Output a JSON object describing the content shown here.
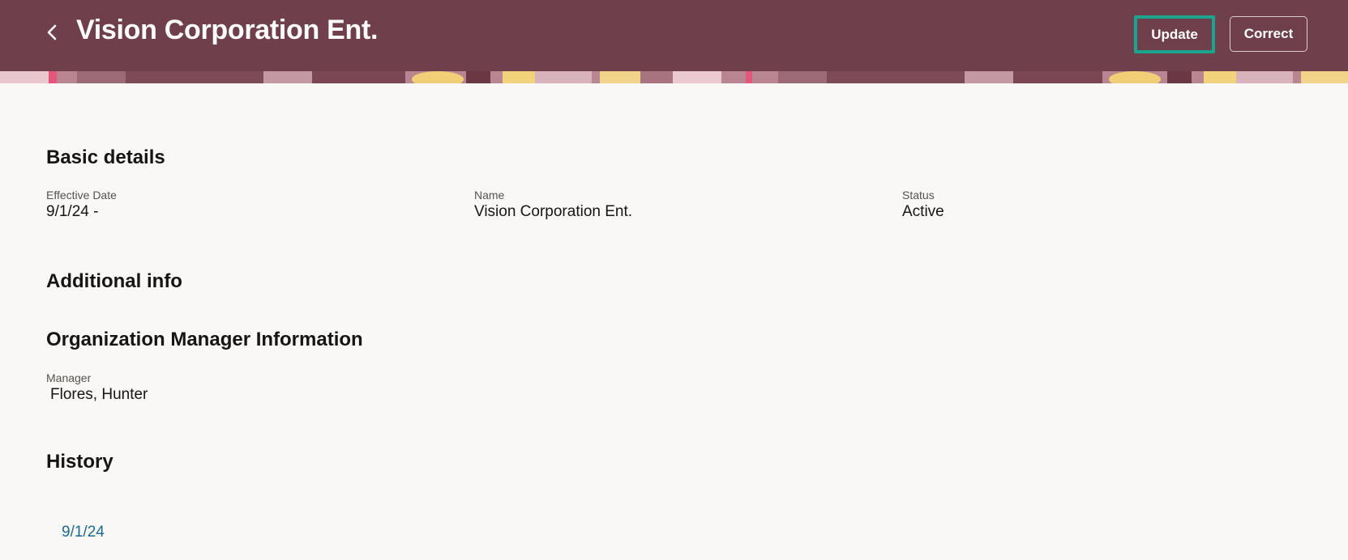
{
  "header": {
    "title": "Vision Corporation Ent.",
    "update_label": "Update",
    "correct_label": "Correct"
  },
  "basic_details": {
    "heading": "Basic details",
    "effective_date": {
      "label": "Effective Date",
      "value": "9/1/24 -"
    },
    "name": {
      "label": "Name",
      "value": "Vision Corporation Ent."
    },
    "status": {
      "label": "Status",
      "value": "Active"
    }
  },
  "additional_info": {
    "heading": "Additional info"
  },
  "org_manager": {
    "heading": "Organization Manager Information",
    "manager": {
      "label": "Manager",
      "value": "Flores, Hunter"
    }
  },
  "history": {
    "heading": "History",
    "entries": [
      "9/1/24"
    ]
  },
  "colors": {
    "header_bg": "#6f3f4b",
    "focus_ring": "#1aa68e",
    "link": "#1c6a8c",
    "page_bg": "#f9f8f6"
  },
  "icons": {
    "back": "chevron-left-icon"
  }
}
